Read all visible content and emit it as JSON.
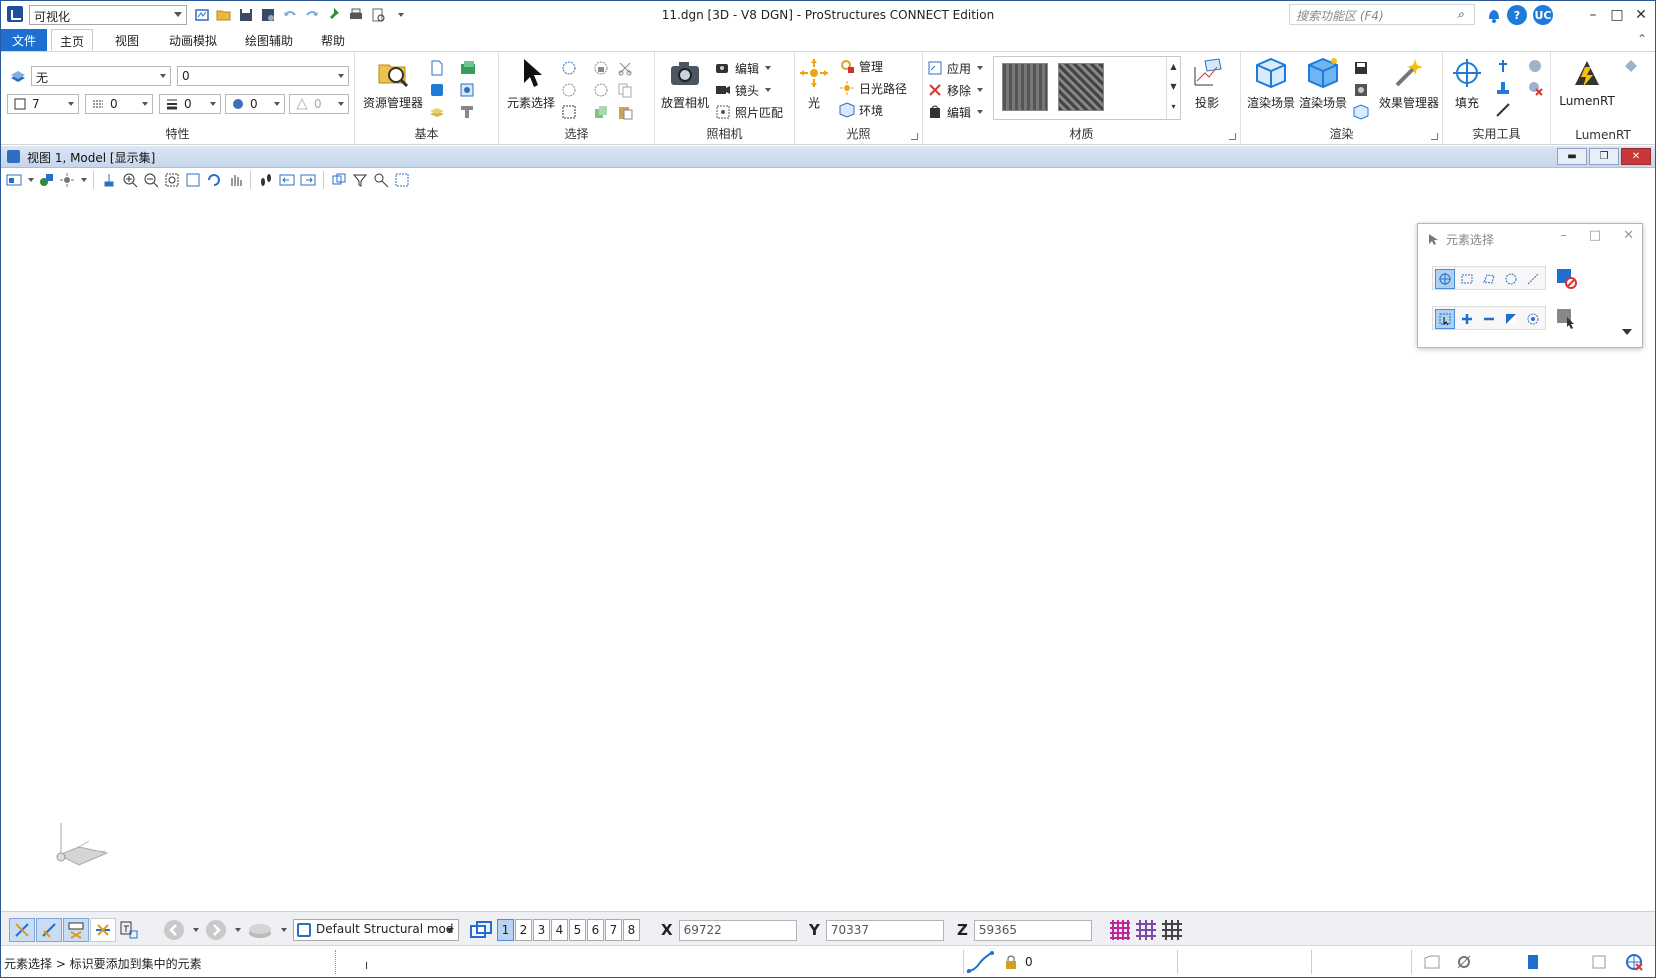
{
  "titlebar": {
    "workflow": "可视化",
    "title": "11.dgn [3D - V8 DGN] - ProStructures CONNECT Edition",
    "search_placeholder": "搜索功能区 (F4)",
    "user_initials": "UC",
    "window_buttons": [
      "minimize",
      "maximize",
      "close"
    ]
  },
  "menu": {
    "file": "文件",
    "tabs": [
      "主页",
      "视图",
      "动画模拟",
      "绘图辅助",
      "帮助"
    ],
    "active_tab": "主页"
  },
  "ribbon": {
    "attributes": {
      "label": "特性",
      "level": "无",
      "style": "0",
      "color": "7",
      "weight": "0",
      "linestyle": "0",
      "transparency": "0",
      "priority": "0"
    },
    "basic": {
      "label": "基本",
      "explorer": "资源管理器"
    },
    "selection": {
      "label": "选择",
      "element_select": "元素选择"
    },
    "camera": {
      "label": "照相机",
      "place_camera": "放置相机",
      "edit": "编辑",
      "lens": "镜头",
      "photo_match": "照片匹配"
    },
    "lighting": {
      "label": "光照",
      "light": "光",
      "manage": "管理",
      "solar_path": "日光路径",
      "environment": "环境"
    },
    "materials": {
      "label": "材质",
      "apply": "应用",
      "remove": "移除",
      "edit": "编辑",
      "projection": "投影"
    },
    "render": {
      "label": "渲染",
      "render_scene_1": "渲染场景",
      "render_scene_2": "渲染场景",
      "effects_manager": "效果管理器"
    },
    "utilities": {
      "label": "实用工具",
      "fill": "填充"
    },
    "lumenrt": {
      "label": "LumenRT",
      "button": "LumenRT"
    }
  },
  "view": {
    "title": "视图 1, Model [显示集]"
  },
  "element_selection": {
    "title": "元素选择"
  },
  "bottom_toolbar": {
    "model": "Default Structural mod",
    "view_numbers": [
      "1",
      "2",
      "3",
      "4",
      "5",
      "6",
      "7",
      "8"
    ],
    "active_view": "1",
    "x_label": "X",
    "x_value": "69722",
    "y_label": "Y",
    "y_value": "70337",
    "z_label": "Z",
    "z_value": "59365"
  },
  "status": {
    "prompt": "元素选择 > 标识要添加到集中的元素",
    "lock_count": "0"
  },
  "colors": {
    "accent": "#1f6fd0",
    "viewbar": "#c7d6ea",
    "grid_magenta": "#c0269a"
  }
}
